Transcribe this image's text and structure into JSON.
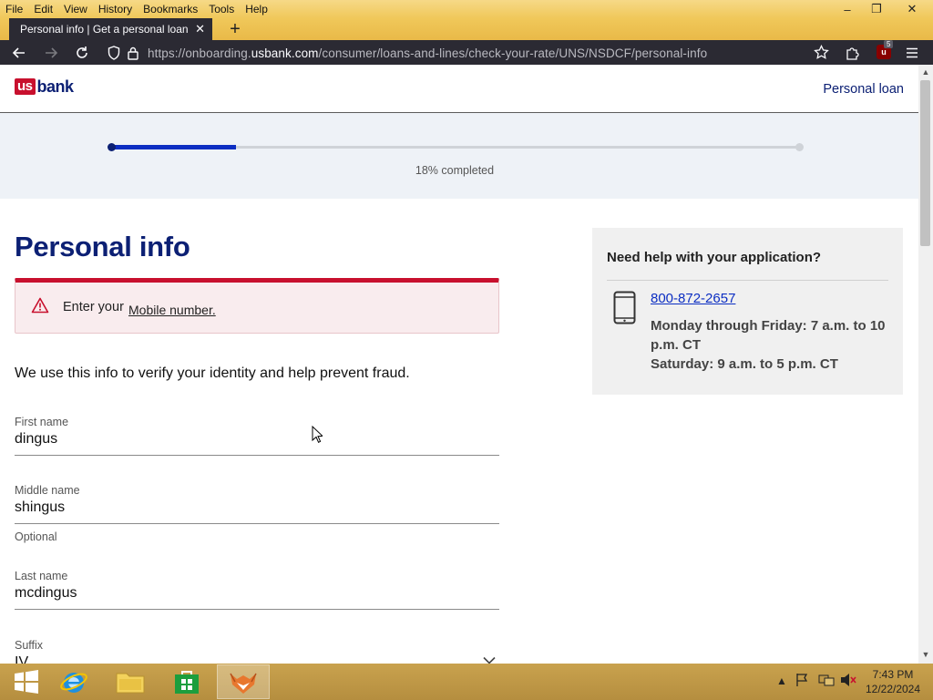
{
  "menu": [
    "File",
    "Edit",
    "View",
    "History",
    "Bookmarks",
    "Tools",
    "Help"
  ],
  "window_controls": {
    "minimize": "–",
    "restore": "❐",
    "close": "✕"
  },
  "tab": {
    "title": "Personal info | Get a personal loan | U",
    "close": "✕",
    "new_tab": "+"
  },
  "url": {
    "prefix": "https://onboarding.",
    "domain": "usbank.com",
    "path": "/consumer/loans-and-lines/check-your-rate/UNS/NSDCF/personal-info"
  },
  "extensions": {
    "ublock_badge": "5"
  },
  "site": {
    "logo_us": "us",
    "logo_bank": "bank",
    "header_link": "Personal loan"
  },
  "progress": {
    "fraction": 0.18,
    "label": "18% completed"
  },
  "page_title": "Personal info",
  "alert": {
    "text": "Enter your",
    "link": "Mobile number."
  },
  "intro": "We use this info to verify your identity and help prevent fraud.",
  "fields": [
    {
      "label": "First name",
      "value": "dingus",
      "helper": ""
    },
    {
      "label": "Middle name",
      "value": "shingus",
      "helper": "Optional"
    },
    {
      "label": "Last name",
      "value": "mcdingus",
      "helper": ""
    },
    {
      "label": "Suffix",
      "value": "IV",
      "helper": ""
    }
  ],
  "help": {
    "title": "Need help with your application?",
    "phone": "800-872-2657",
    "hours_weekday": "Monday through Friday: 7 a.m. to 10 p.m. CT",
    "hours_saturday": "Saturday: 9 a.m. to 5 p.m. CT"
  },
  "taskbar": {
    "time": "7:43 PM",
    "date": "12/22/2024"
  },
  "colors": {
    "brand_navy": "#0c2074",
    "brand_red": "#c8102e",
    "progress_blue": "#0c2ec2"
  }
}
